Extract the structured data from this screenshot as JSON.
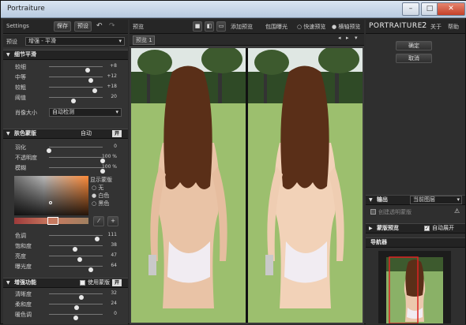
{
  "window": {
    "title": "Portraiture"
  },
  "left": {
    "tool": {
      "settings": "Settings",
      "save": "保存",
      "preset": "预设"
    },
    "preset_label": "预设",
    "preset_value": "增强 - 平滑",
    "detail": {
      "title": "细节平滑",
      "sliders": [
        {
          "label": "较细",
          "value": "+8",
          "pct": 0.72
        },
        {
          "label": "中等",
          "value": "+12",
          "pct": 0.78
        },
        {
          "label": "较粗",
          "value": "+18",
          "pct": 0.85
        },
        {
          "label": "阈值",
          "value": "20",
          "pct": 0.45
        }
      ],
      "size_label": "肖像大小",
      "size_value": "自动检测"
    },
    "mask": {
      "title": "肤色蒙版",
      "mode": "自动",
      "toggle": "开",
      "sliders": [
        {
          "label": "羽化",
          "value": "0",
          "pct": 0.0
        },
        {
          "label": "不透明度",
          "value": "100 %",
          "pct": 1.0
        },
        {
          "label": "模糊",
          "value": "100 %",
          "pct": 1.0
        }
      ],
      "show_label": "显示蒙版",
      "opts": [
        "无",
        "白色",
        "黑色"
      ],
      "sliders2": [
        {
          "label": "色调",
          "value": "111",
          "pct": 0.9
        },
        {
          "label": "饱和度",
          "value": "38",
          "pct": 0.48
        },
        {
          "label": "亮度",
          "value": "47",
          "pct": 0.58
        },
        {
          "label": "曝光度",
          "value": "64",
          "pct": 0.78
        }
      ]
    },
    "enhance": {
      "title": "增强功能",
      "use_mask": "使用蒙版",
      "sliders": [
        {
          "label": "清晰度",
          "value": "32",
          "pct": 0.6
        },
        {
          "label": "柔和度",
          "value": "24",
          "pct": 0.52
        },
        {
          "label": "暖色调",
          "value": "0",
          "pct": 0.5
        }
      ]
    }
  },
  "main": {
    "tool": {
      "label": "预览",
      "add_preview": "添加预览",
      "clip": "包围曝光",
      "quick": "快速预览",
      "split": "横轴预览"
    },
    "tab": "预览 1"
  },
  "right": {
    "brand": "PORTRAITURE",
    "version": "2",
    "close": "关于",
    "help": "帮助",
    "ok": "确定",
    "cancel": "取消",
    "output": {
      "title": "输出",
      "value": "当前图层",
      "create_layer": "创建透明蒙版"
    },
    "mask_preview": {
      "title": "蒙版预览",
      "auto": "自动展开"
    },
    "navigator": {
      "title": "导航器"
    }
  },
  "colors": {
    "bg": "#2e2e2e",
    "panel": "#333333",
    "grass": "#7aa05a",
    "sky": "#e8ecea"
  }
}
